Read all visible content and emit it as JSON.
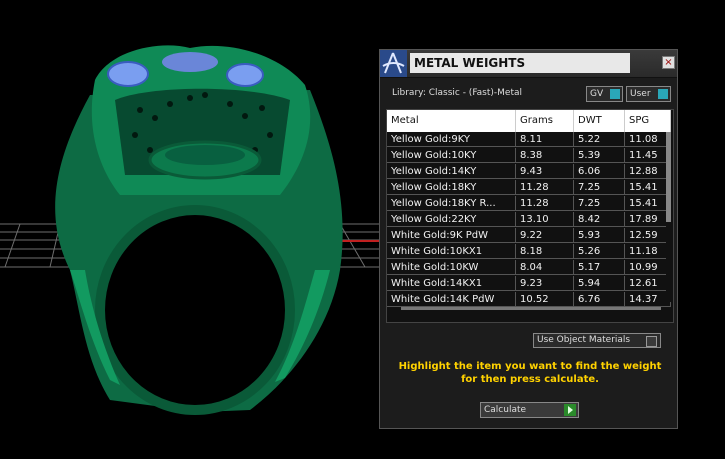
{
  "panel": {
    "title": "METAL WEIGHTS",
    "close_glyph": "×",
    "library": "Library: Classic - (Fast)-Metal",
    "toggles": {
      "gv": "GV",
      "user": "User"
    },
    "table": {
      "headers": [
        "Metal",
        "Grams",
        "DWT",
        "SPG"
      ],
      "rows": [
        [
          "Yellow Gold:9KY",
          "8.11",
          "5.22",
          "11.08"
        ],
        [
          "Yellow Gold:10KY",
          "8.38",
          "5.39",
          "11.45"
        ],
        [
          "Yellow Gold:14KY",
          "9.43",
          "6.06",
          "12.88"
        ],
        [
          "Yellow Gold:18KY",
          "11.28",
          "7.25",
          "15.41"
        ],
        [
          "Yellow Gold:18KY R...",
          "11.28",
          "7.25",
          "15.41"
        ],
        [
          "Yellow Gold:22KY",
          "13.10",
          "8.42",
          "17.89"
        ],
        [
          "White Gold:9K PdW",
          "9.22",
          "5.93",
          "12.59"
        ],
        [
          "White Gold:10KX1",
          "8.18",
          "5.26",
          "11.18"
        ],
        [
          "White Gold:10KW",
          "8.04",
          "5.17",
          "10.99"
        ],
        [
          "White Gold:14KX1",
          "9.23",
          "5.94",
          "12.61"
        ],
        [
          "White Gold:14K PdW",
          "10.52",
          "6.76",
          "14.37"
        ]
      ]
    },
    "use_object_materials": "Use Object Materials",
    "instruction_line1": "Highlight the item you want to find the weight",
    "instruction_line2": "for then press calculate.",
    "calculate_label": "Calculate"
  },
  "colors": {
    "ring": "#0e7a4e",
    "gem": "#7a9ef0",
    "grid": "#7a7a7a",
    "instruction": "#ffd200"
  }
}
